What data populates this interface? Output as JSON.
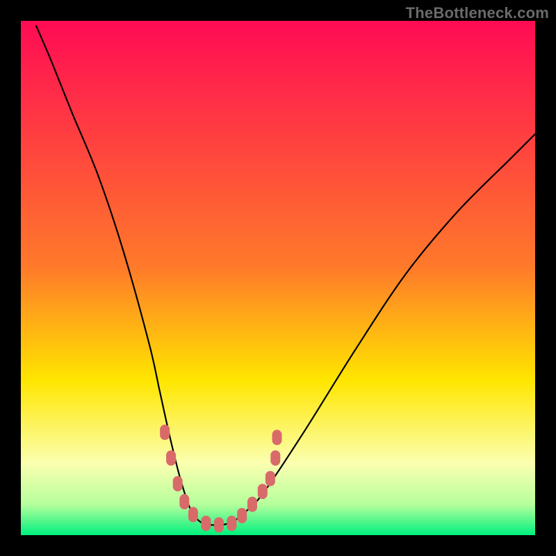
{
  "watermark": "TheBottleneck.com",
  "colors": {
    "frame_bg": "#000000",
    "grad_top": "#ff0b54",
    "grad_mid": "#ffe600",
    "grad_bottom_yellowwhite": "#fbffb0",
    "grad_green_edge": "#00f07e",
    "curve": "#000000",
    "marker": "#d96a6a"
  },
  "chart_data": {
    "type": "line",
    "title": "",
    "xlabel": "",
    "ylabel": "",
    "x_range": [
      0,
      100
    ],
    "y_range": [
      0,
      100
    ],
    "note": "Single V-shaped curve on a vertical RYG gradient. Axes and ticks are not shown; x/y values are in percent of the plot area.",
    "series": [
      {
        "name": "curve",
        "x": [
          3,
          6,
          10,
          15,
          20,
          25,
          27,
          29,
          31,
          33,
          35,
          37,
          39,
          41,
          43,
          47,
          55,
          65,
          75,
          85,
          95,
          100
        ],
        "y": [
          99,
          92,
          82,
          70,
          55,
          37,
          28,
          19,
          11,
          5,
          2.5,
          2,
          2,
          2.5,
          4,
          8,
          20,
          36,
          51,
          63,
          73,
          78
        ]
      }
    ],
    "markers": {
      "comment": "Salmon rounded dashes near the valley, in plot-area percent coords",
      "points": [
        {
          "x": 28.0,
          "y": 20.0
        },
        {
          "x": 29.2,
          "y": 15.0
        },
        {
          "x": 30.5,
          "y": 10.0
        },
        {
          "x": 31.8,
          "y": 6.5
        },
        {
          "x": 33.5,
          "y": 4.0
        },
        {
          "x": 36.0,
          "y": 2.3
        },
        {
          "x": 38.5,
          "y": 2.0
        },
        {
          "x": 41.0,
          "y": 2.3
        },
        {
          "x": 43.0,
          "y": 3.8
        },
        {
          "x": 45.0,
          "y": 6.0
        },
        {
          "x": 47.0,
          "y": 8.5
        },
        {
          "x": 48.5,
          "y": 11.0
        },
        {
          "x": 49.5,
          "y": 15.0
        },
        {
          "x": 49.8,
          "y": 19.0
        }
      ]
    }
  }
}
